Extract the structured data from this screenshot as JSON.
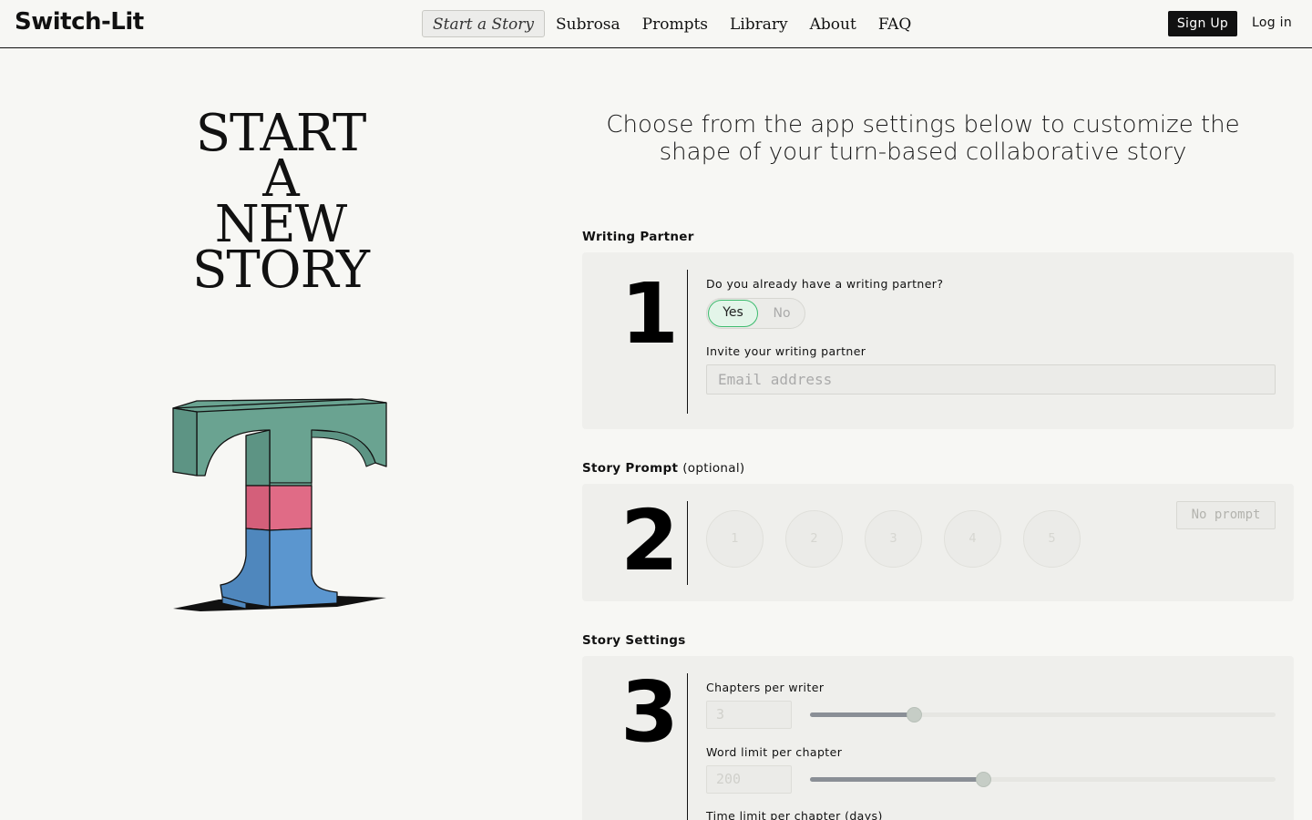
{
  "header": {
    "logo": "Switch-Lit",
    "nav": [
      {
        "label": "Start a Story",
        "active": true
      },
      {
        "label": "Subrosa",
        "active": false
      },
      {
        "label": "Prompts",
        "active": false
      },
      {
        "label": "Library",
        "active": false
      },
      {
        "label": "About",
        "active": false
      },
      {
        "label": "FAQ",
        "active": false
      }
    ],
    "signup": "Sign Up",
    "login": "Log in"
  },
  "hero": {
    "title_lines": [
      "START",
      "A",
      "NEW",
      "STORY"
    ],
    "art_icon": "letter-t-3d-illustration",
    "art_colors": {
      "top": "#6aa391",
      "middle": "#e06b86",
      "bottom": "#5b96cf",
      "shadow": "#111111"
    }
  },
  "intro": "Choose from the app settings below to customize the shape of your turn-based collaborative story",
  "sections": {
    "partner": {
      "label": "Writing Partner",
      "number": "1",
      "question": "Do you already have a writing partner?",
      "yes": "Yes",
      "no": "No",
      "selected": "Yes",
      "invite_label": "Invite your writing partner",
      "email_placeholder": "Email address"
    },
    "prompt": {
      "label": "Story Prompt",
      "optional": "(optional)",
      "number": "2",
      "options": [
        "1",
        "2",
        "3",
        "4",
        "5"
      ],
      "no_prompt": "No prompt"
    },
    "settings": {
      "label": "Story Settings",
      "number": "3",
      "chapters": {
        "label": "Chapters per writer",
        "value": "3",
        "slider_fraction": 0.224
      },
      "words": {
        "label": "Word limit per chapter",
        "value": "200",
        "slider_fraction": 0.371
      },
      "time": {
        "label": "Time limit per chapter (days)"
      }
    }
  },
  "colors": {
    "accent_green": "#3dbb6e",
    "panel": "#efefec",
    "background": "#f7f7f4"
  }
}
